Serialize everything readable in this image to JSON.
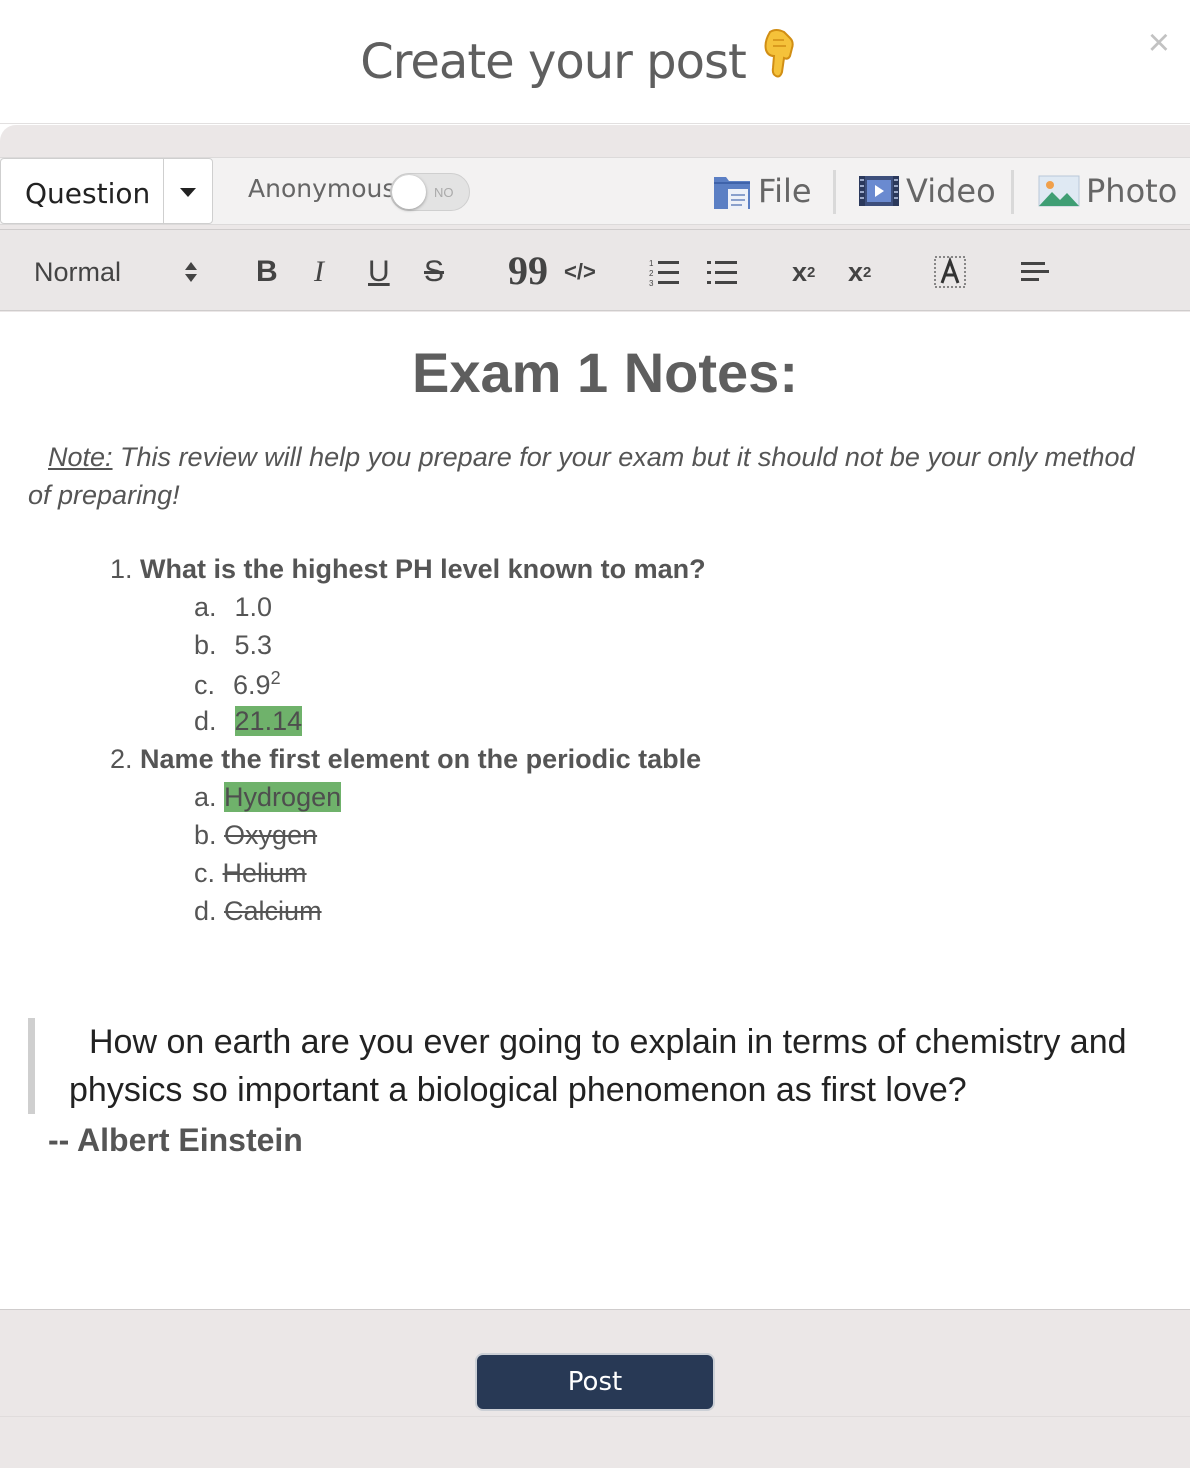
{
  "modal": {
    "title": "Create your post",
    "close_label": "×"
  },
  "post_type": {
    "selected": "Question",
    "anonymous_label": "Anonymous",
    "anonymous_state": "NO"
  },
  "media": {
    "file_label": "File",
    "video_label": "Video",
    "photo_label": "Photo"
  },
  "toolbar": {
    "heading_select": "Normal",
    "bold": "B",
    "italic": "I",
    "underline": "U",
    "strike": "S",
    "blockquote": "99",
    "code": "</>",
    "subscript": "x",
    "subscript_mark": "2",
    "superscript": "x",
    "superscript_mark": "2"
  },
  "editor": {
    "heading": "Exam 1 Notes:",
    "note_lead": "Note:",
    "note_text": " This review will help you prepare for your exam but it should not be your only method  of preparing!",
    "questions": [
      {
        "number": "1.",
        "text": "What is the highest PH level known to man?",
        "options": [
          {
            "letter": "a.",
            "value": "1.0"
          },
          {
            "letter": "b.",
            "value": "5.3"
          },
          {
            "letter": "c.",
            "value": "6.9",
            "sup": "2"
          },
          {
            "letter": "d.",
            "value": "21.14"
          }
        ]
      },
      {
        "number": "2.",
        "text": "Name the first element on the periodic table",
        "options": [
          {
            "letter": "a.",
            "value": "Hydrogen"
          },
          {
            "letter": "b.",
            "value": "Oxygen"
          },
          {
            "letter": "c.",
            "value": "Helium"
          },
          {
            "letter": "d.",
            "value": "Calcium"
          }
        ]
      }
    ],
    "quote": "How on earth are you ever going to explain in terms of chemistry and physics so important a biological phenomenon as first love?",
    "author": "-- Albert Einstein"
  },
  "footer": {
    "post_label": "Post"
  },
  "colors": {
    "highlight": "#6fb26b",
    "post_button": "#283955",
    "panel": "#ebe7e7"
  },
  "icons": [
    "pointing-hand-icon",
    "close-icon",
    "caret-down-icon",
    "file-icon",
    "video-icon",
    "photo-icon",
    "updown-arrows-icon",
    "ordered-list-icon",
    "bullet-list-icon",
    "clear-format-icon",
    "align-left-icon"
  ]
}
